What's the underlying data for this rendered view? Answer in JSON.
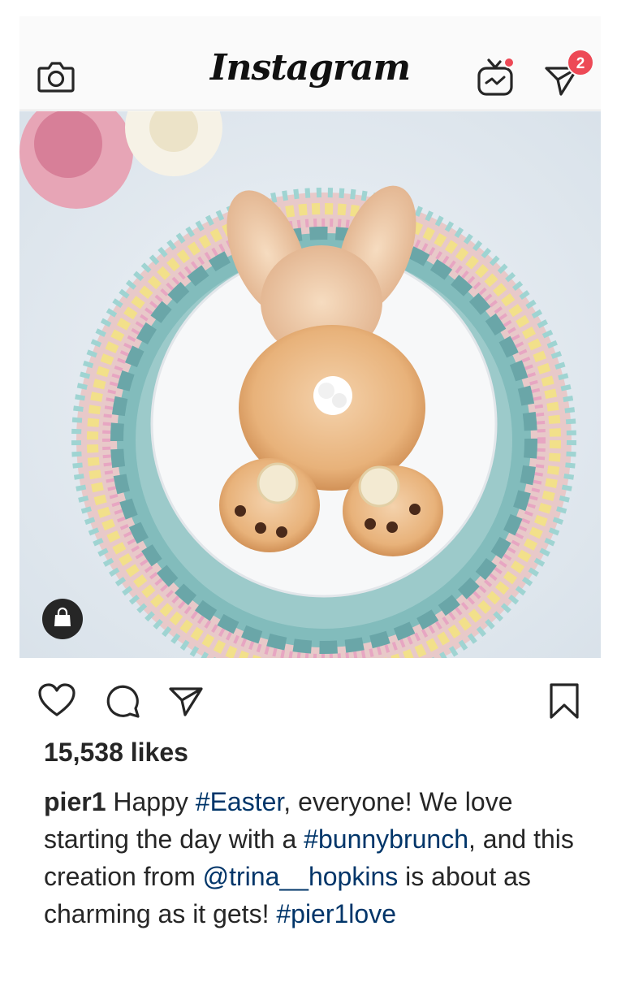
{
  "header": {
    "app_name": "Instagram",
    "camera_icon": "camera-icon",
    "igtv_icon": "igtv-icon",
    "direct_icon": "paper-plane-icon",
    "direct_badge_count": "2",
    "accent": "#ed4956"
  },
  "post": {
    "image_icon": "shopping-bag-icon",
    "likes": "15,538 likes",
    "caption": {
      "username": "pier1",
      "text_1": " Happy ",
      "hashtag_1": "#Easter",
      "text_2": ", everyone! We love starting the day with a ",
      "hashtag_2": "#bunnybrunch",
      "text_3": ", and this creation from ",
      "mention": "@trina__hopkins",
      "text_4": " is about as charming as it gets! ",
      "hashtag_3": "#pier1love"
    },
    "link_color": "#003569"
  },
  "actions": {
    "like_icon": "heart-icon",
    "comment_icon": "comment-icon",
    "share_icon": "share-icon",
    "save_icon": "bookmark-icon"
  }
}
